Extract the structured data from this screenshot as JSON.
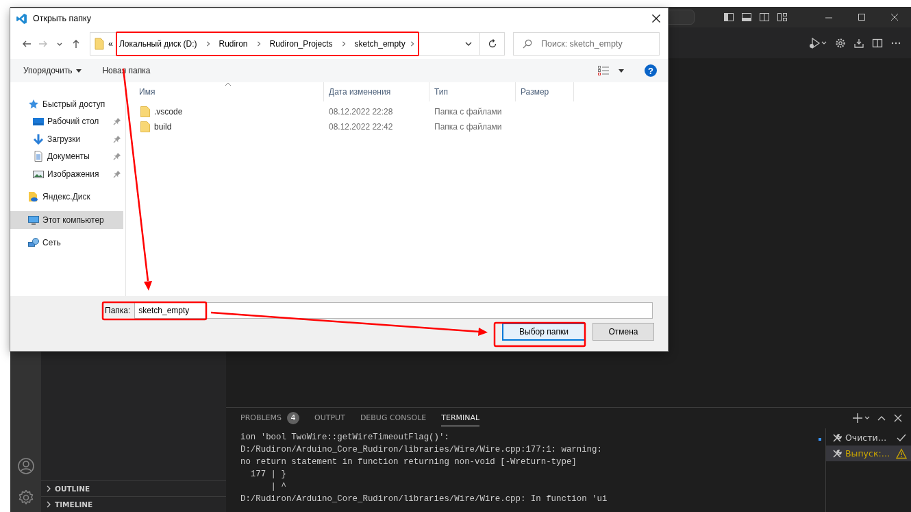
{
  "vscode": {
    "sidebar": {
      "sections": [
        {
          "label": "OUTLINE",
          "expanded": false
        },
        {
          "label": "TIMELINE",
          "expanded": false
        }
      ]
    },
    "panel": {
      "tabs": [
        {
          "label": "PROBLEMS",
          "badge": "4",
          "selected": false
        },
        {
          "label": "OUTPUT",
          "selected": false
        },
        {
          "label": "DEBUG CONSOLE",
          "selected": false
        },
        {
          "label": "TERMINAL",
          "selected": true
        }
      ],
      "terminal_lines": [
        "ion 'bool TwoWire::getWireTimeoutFlag()':",
        "D:/Rudiron/Arduino_Core_Rudiron/libraries/Wire/Wire.cpp:177:1: warning:",
        "no return statement in function returning non-void [-Wreturn-type]",
        "  177 | }",
        "      | ^",
        "D:/Rudiron/Arduino_Core_Rudiron/libraries/Wire/Wire.cpp: In function 'ui"
      ],
      "tasks": [
        {
          "label": "Очисти…",
          "kind": "success",
          "selected": false
        },
        {
          "label": "Выпуск:…",
          "kind": "warning",
          "selected": true
        }
      ]
    }
  },
  "dialog": {
    "title": "Открыть папку",
    "breadcrumb_overflow": "«",
    "breadcrumb": [
      "Локальный диск (D:)",
      "Rudiron",
      "Rudiron_Projects",
      "sketch_empty"
    ],
    "search": {
      "placeholder": "Поиск: sketch_empty"
    },
    "commands": {
      "organize": "Упорядочить",
      "new_folder": "Новая папка",
      "help": "?"
    },
    "nav": [
      {
        "label": "Быстрый доступ",
        "kind": "star",
        "selected": false,
        "children": [
          {
            "label": "Рабочий стол",
            "kind": "desktop",
            "pinned": true,
            "selected": false
          },
          {
            "label": "Загрузки",
            "kind": "download",
            "pinned": true,
            "selected": false
          },
          {
            "label": "Документы",
            "kind": "document",
            "pinned": true,
            "selected": false
          },
          {
            "label": "Изображения",
            "kind": "pictures",
            "pinned": true,
            "selected": false
          }
        ]
      },
      {
        "label": "Яндекс.Диск",
        "kind": "cloud",
        "selected": false
      },
      {
        "label": "Этот компьютер",
        "kind": "computer",
        "selected": true
      },
      {
        "label": "Сеть",
        "kind": "network",
        "selected": false
      }
    ],
    "columns": [
      {
        "label": "Имя",
        "sorted": true
      },
      {
        "label": "Дата изменения",
        "sorted": false
      },
      {
        "label": "Тип",
        "sorted": false
      },
      {
        "label": "Размер",
        "sorted": false
      }
    ],
    "rows": [
      {
        "name": ".vscode",
        "date": "08.12.2022 22:28",
        "type": "Папка с файлами"
      },
      {
        "name": "build",
        "date": "08.12.2022 22:42",
        "type": "Папка с файлами"
      }
    ],
    "folder": {
      "label": "Папка:",
      "value": "sketch_empty"
    },
    "buttons": [
      {
        "label": "Выбор папки",
        "default": true
      },
      {
        "label": "Отмена",
        "default": false
      }
    ]
  }
}
